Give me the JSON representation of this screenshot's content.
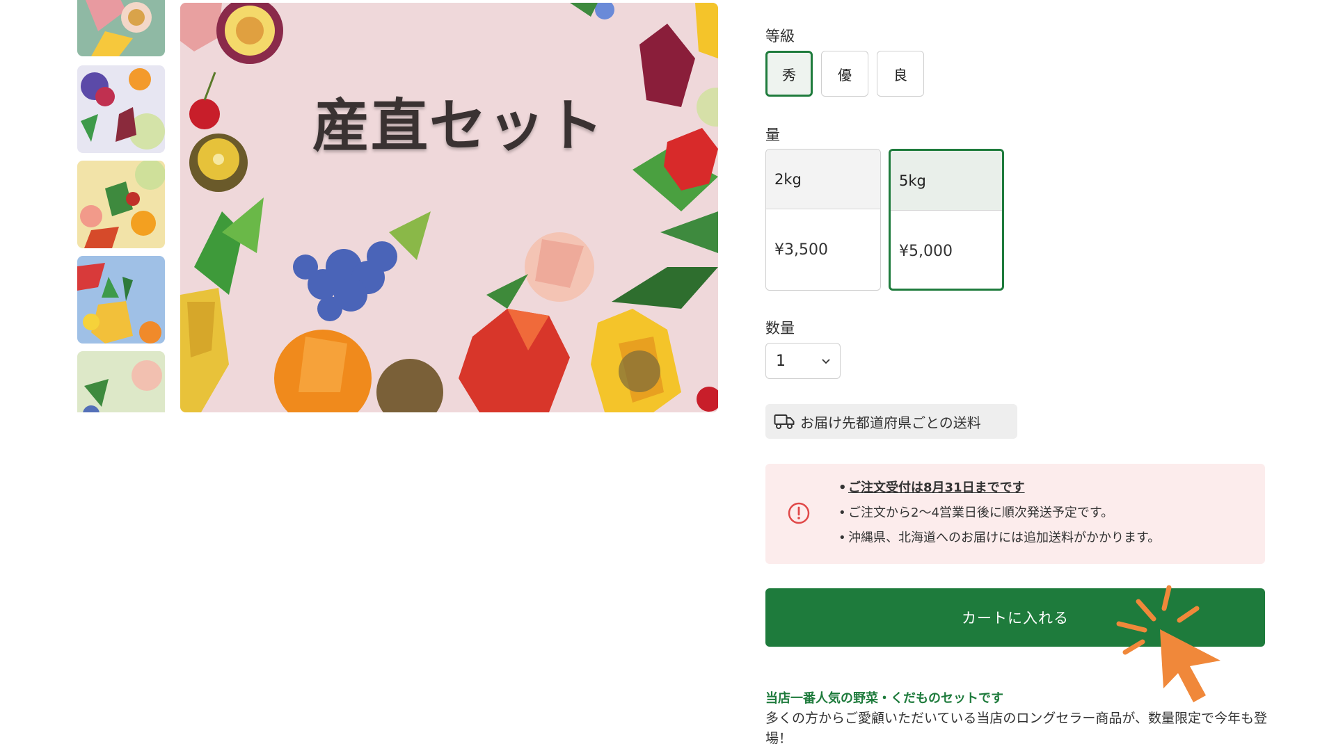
{
  "gallery": {
    "thumbnails": [
      "thumbnail-1",
      "thumbnail-2",
      "thumbnail-3",
      "thumbnail-4",
      "thumbnail-5"
    ],
    "main_title": "産直セット"
  },
  "grade": {
    "label": "等級",
    "options": [
      "秀",
      "優",
      "良"
    ],
    "selected": "秀"
  },
  "quantity_size": {
    "label": "量",
    "options": [
      {
        "size": "2kg",
        "price": "¥3,500"
      },
      {
        "size": "5kg",
        "price": "¥5,000"
      }
    ],
    "selected": "5kg"
  },
  "count": {
    "label": "数量",
    "value": "1"
  },
  "shipping": {
    "label": "お届け先都道府県ごとの送料",
    "icon": "truck-icon"
  },
  "notice": {
    "icon": "alert-circle-icon",
    "items": [
      "ご注文受付は8月31日までです",
      "ご注文から2〜4営業日後に順次発送予定です。",
      "沖縄県、北海道へのお届けには追加送料がかかります。"
    ]
  },
  "cart": {
    "label": "カートに入れる"
  },
  "description": {
    "title": "当店一番人気の野菜・くだものセットです",
    "body": "多くの方からご愛顧いただいている当店のロングセラー商品が、数量限定で今年も登場！"
  },
  "colors": {
    "accent": "#1e7b3c",
    "notice_bg": "#fcecec",
    "alert": "#e04848",
    "cursor": "#f0883a"
  }
}
